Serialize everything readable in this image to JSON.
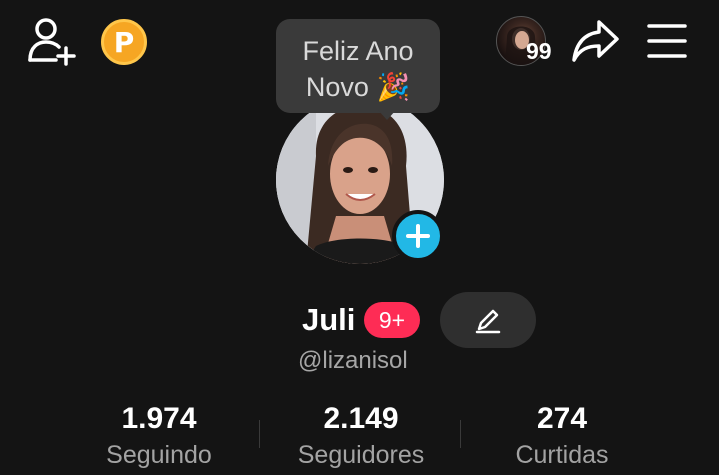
{
  "header": {
    "add_friend_icon": "person-plus-icon",
    "coin_label": "P",
    "viewers_count": "99",
    "share_icon": "share-arrow-icon",
    "menu_icon": "hamburger-menu-icon"
  },
  "tooltip": {
    "line1": "Feliz Ano",
    "line2": "Novo 🎉"
  },
  "profile": {
    "name": "Juli",
    "badge": "9+",
    "handle": "@lizanisol"
  },
  "stats": [
    {
      "value": "1.974",
      "label": "Seguindo"
    },
    {
      "value": "2.149",
      "label": "Seguidores"
    },
    {
      "value": "274",
      "label": "Curtidas"
    }
  ],
  "colors": {
    "background": "#141414",
    "coin": "#f6a623",
    "add_story": "#22b8e6",
    "badge": "#fe2c55"
  }
}
